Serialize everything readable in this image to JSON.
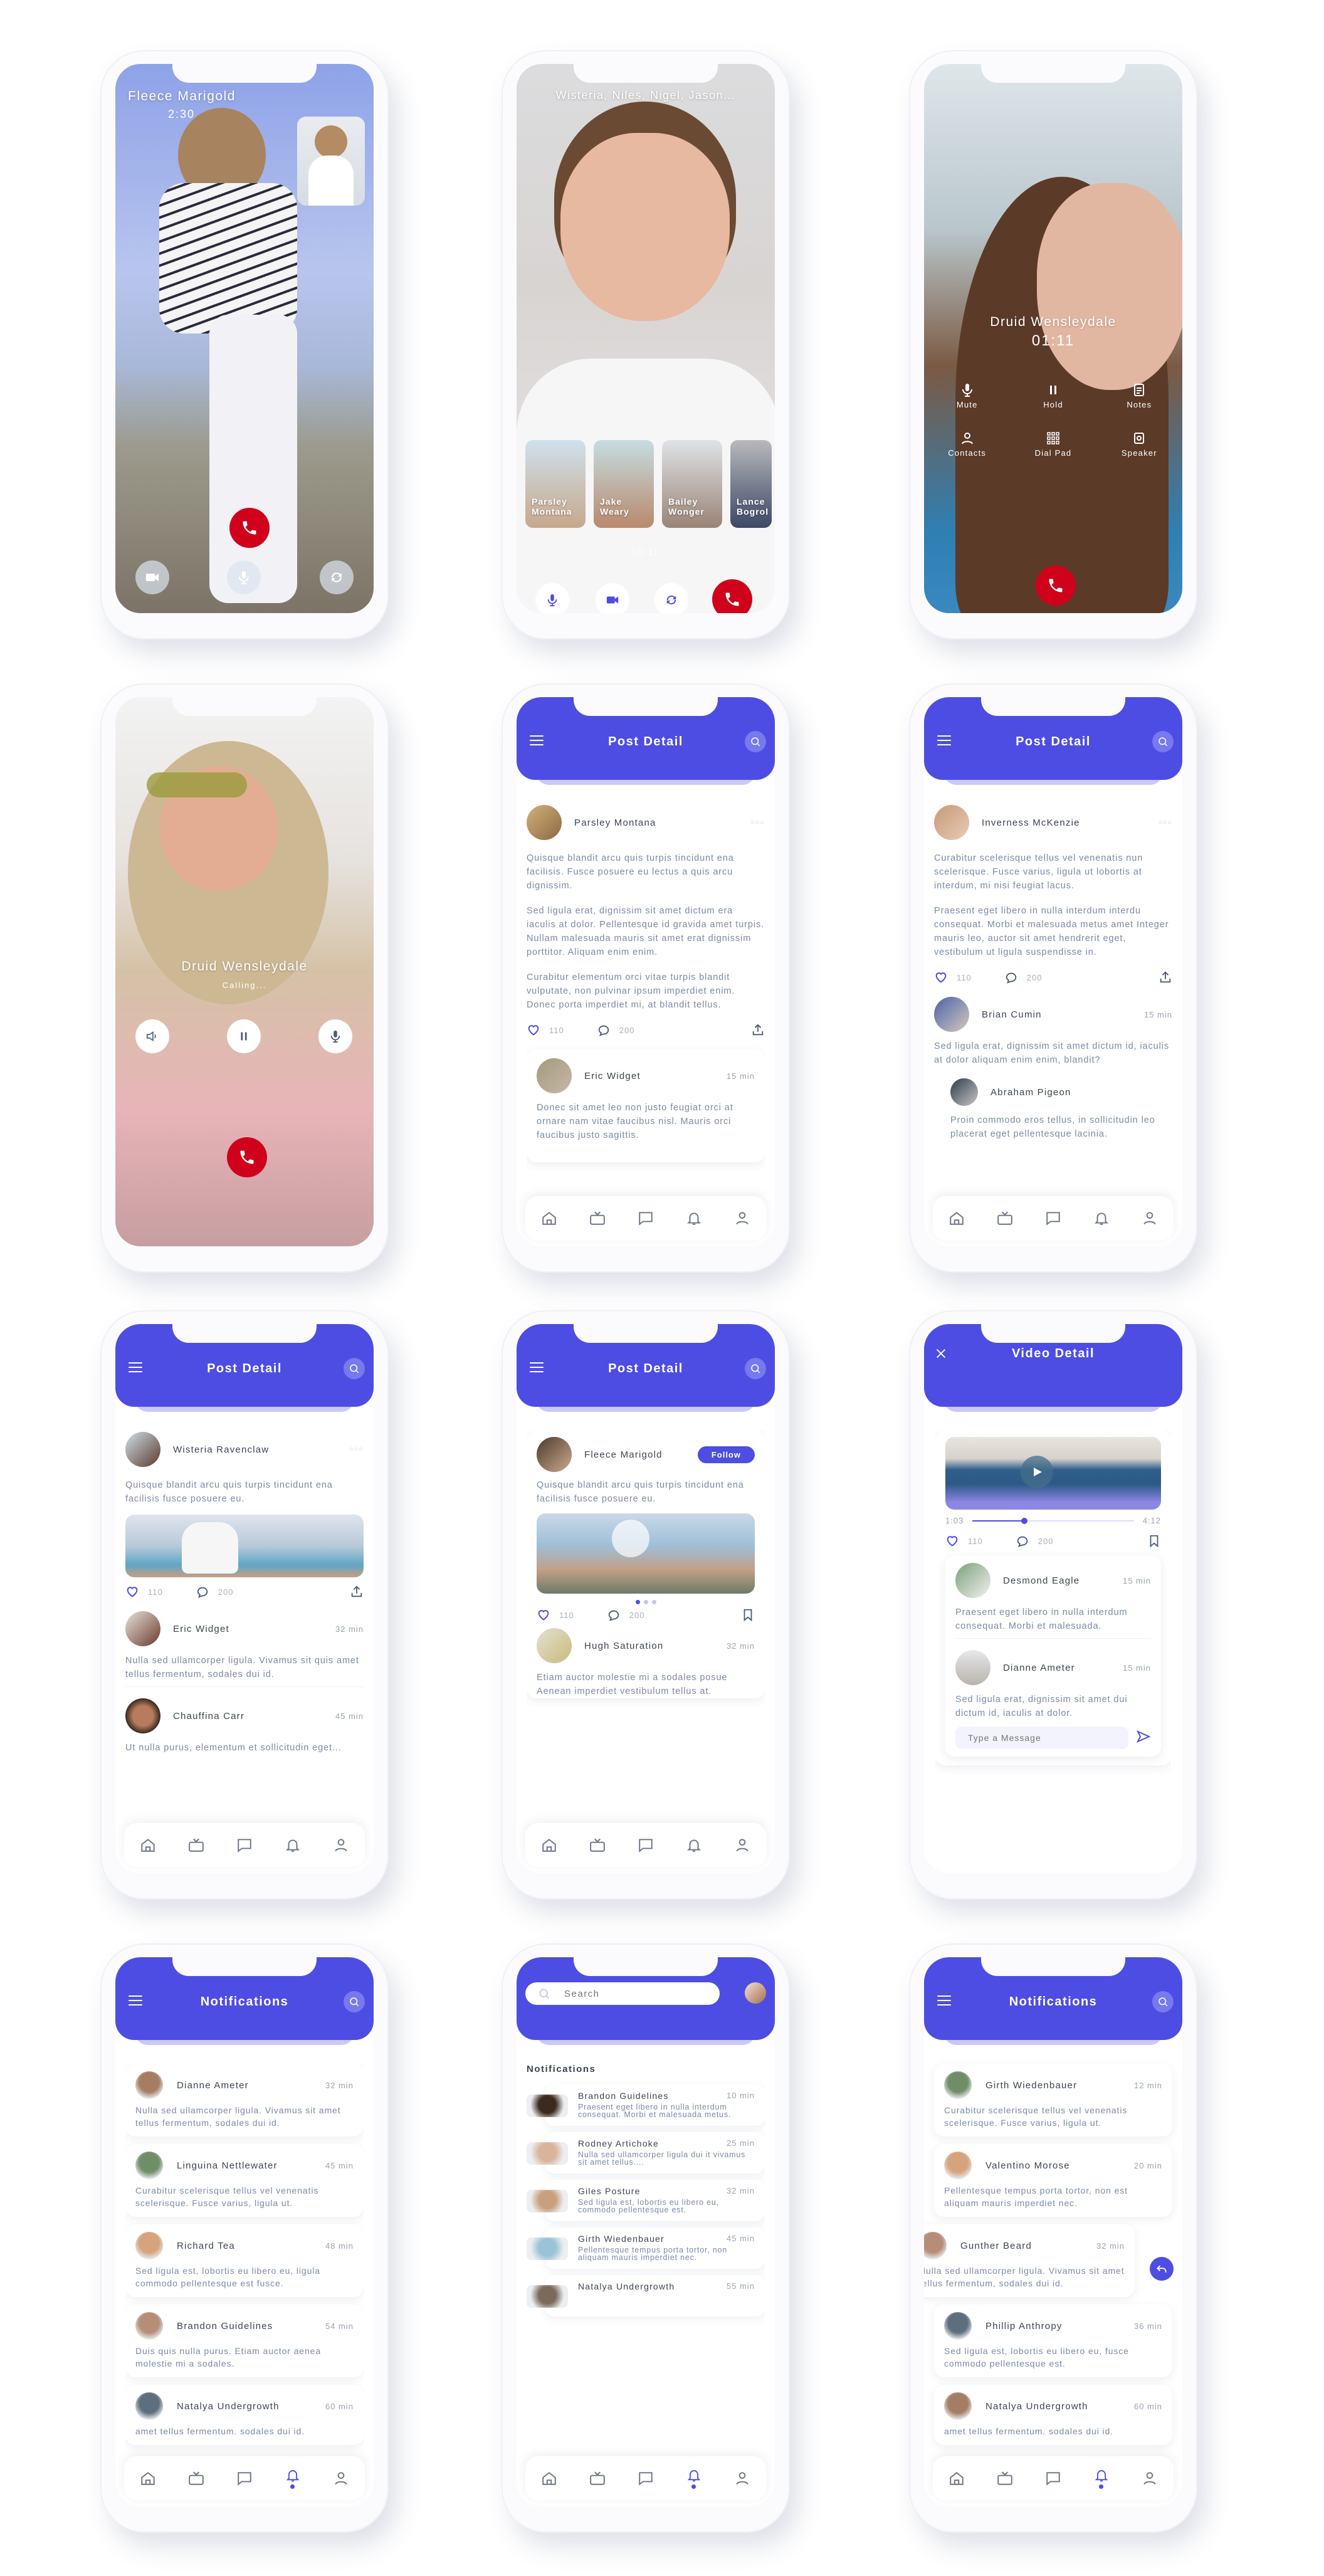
{
  "theme": {
    "accent": "#4d4de4",
    "end_call": "#d0021b",
    "text": "#3c4455",
    "muted": "#7a8aa6"
  },
  "screens": {
    "video_call_1v1": {
      "caller_name": "Fleece Marigold",
      "duration": "2:30",
      "controls": [
        "video-camera-icon",
        "microphone-icon",
        "switch-camera-icon"
      ],
      "end_call_icon": "phone-icon"
    },
    "group_video_call": {
      "participants_title": "Wisteria, Niles, Nigel, Jason...",
      "duration": "05:11",
      "participants": [
        {
          "first": "Parsley",
          "last": "Montana"
        },
        {
          "first": "Jake",
          "last": "Weary"
        },
        {
          "first": "Bailey",
          "last": "Wonger"
        },
        {
          "first": "Lance",
          "last": "Bogrol"
        }
      ],
      "controls": [
        "microphone-icon",
        "video-camera-icon",
        "switch-camera-icon",
        "phone-icon"
      ]
    },
    "audio_call_active": {
      "caller_name": "Druid Wensleydale",
      "duration": "01:11",
      "actions": [
        {
          "label": "Mute",
          "icon": "mute-icon"
        },
        {
          "label": "Hold",
          "icon": "pause-icon"
        },
        {
          "label": "Notes",
          "icon": "notes-icon"
        },
        {
          "label": "Contacts",
          "icon": "contacts-icon"
        },
        {
          "label": "Dial Pad",
          "icon": "dialpad-icon"
        },
        {
          "label": "Speaker",
          "icon": "speaker-icon"
        }
      ]
    },
    "audio_call_calling": {
      "caller_name": "Druid Wensleydale",
      "status": "Calling...",
      "controls": [
        "speaker-icon",
        "pause-icon",
        "microphone-icon"
      ]
    },
    "post_detail_text": {
      "title": "Post Detail",
      "author": "Parsley Montana",
      "paragraphs": [
        "Quisque blandit arcu quis turpis tincidunt ena facilisis. Fusce posuere eu lectus a quis arcu dignissim.",
        "Sed ligula erat, dignissim sit amet dictum era iaculis at dolor. Pellentesque id gravida amet turpis. Nullam malesuada mauris sit amet erat dignissim porttitor. Aliquam enim enim.",
        "Curabitur elementum orci vitae turpis blandit vulputate, non pulvinar ipsum imperdiet enim. Donec porta imperdiet mi, at blandit tellus."
      ],
      "likes": "110",
      "comments": "200",
      "comment": {
        "author": "Eric Widget",
        "time": "15 min",
        "text": "Donec sit amet leo non justo feugiat orci at ornare nam vitae faucibus nisl. Mauris orci faucibus justo sagittis."
      }
    },
    "post_detail_thread": {
      "title": "Post Detail",
      "author": "Inverness McKenzie",
      "paragraphs": [
        "Curabitur scelerisque tellus vel venenatis nun scelerisque. Fusce varius, ligula ut lobortis at interdum, mi nisi feugiat lacus.",
        "Praesent eget libero in nulla interdum interdu consequat. Morbi et malesuada metus amet Integer mauris leo, auctor sit amet hendrerit eget, vestibulum ut ligula suspendisse in."
      ],
      "likes": "110",
      "comments": "200",
      "comment": {
        "author": "Brian Cumin",
        "time": "15 min",
        "text": "Sed ligula erat, dignissim sit amet dictum id, iaculis at dolor aliquam enim enim, blandit?"
      },
      "reply": {
        "author": "Abraham Pigeon",
        "text": "Proin commodo eros tellus, in sollicitudin leo placerat eget pellentesque lacinia."
      }
    },
    "post_detail_image": {
      "title": "Post Detail",
      "author": "Wisteria Ravenclaw",
      "text": "Quisque blandit arcu quis turpis tincidunt ena facilisis fusce posuere eu.",
      "likes": "110",
      "comments": "200",
      "comments_list": [
        {
          "author": "Eric Widget",
          "time": "32 min",
          "text": "Nulla sed ullamcorper ligula. Vivamus sit quis amet tellus fermentum, sodales dui id."
        },
        {
          "author": "Chauffina Carr",
          "time": "45 min",
          "text": "Ut nulla purus, elementum et sollicitudin eget..."
        }
      ]
    },
    "post_detail_follow": {
      "title": "Post Detail",
      "author": "Fleece Marigold",
      "follow_label": "Follow",
      "text": "Quisque blandit arcu quis turpis tincidunt ena facilisis fusce posuere eu.",
      "carousel": {
        "total": 3,
        "active": 1
      },
      "likes": "110",
      "comments": "200",
      "comment": {
        "author": "Hugh Saturation",
        "time": "32 min",
        "text": "Etiam auctor molestie mi a sodales posue Aenean imperdiet vestibulum tellus at."
      }
    },
    "video_detail": {
      "title": "Video Detail",
      "elapsed": "1:03",
      "total": "4:12",
      "progress": 0.32,
      "likes": "110",
      "comments": "200",
      "comments_list": [
        {
          "author": "Desmond Eagle",
          "time": "15 min",
          "text": "Praesent eget libero in nulla interdum consequat. Morbi et malesuada."
        },
        {
          "author": "Dianne Ameter",
          "time": "15 min",
          "text": "Sed ligula erat, dignissim sit amet dui dictum id, iaculis at dolor."
        }
      ],
      "message_placeholder": "Type a Message"
    },
    "notifications_cards": {
      "title": "Notifications",
      "items": [
        {
          "author": "Dianne Ameter",
          "time": "32 min",
          "text": "Nulla sed ullamcorper ligula. Vivamus sit amet tellus fermentum, sodales dui id."
        },
        {
          "author": "Linguina Nettlewater",
          "time": "45 min",
          "text": "Curabitur scelerisque tellus vel venenatis scelerisque. Fusce varius, ligula ut."
        },
        {
          "author": "Richard Tea",
          "time": "48 min",
          "text": "Sed ligula est, lobortis eu libero eu, ligula commodo pellentesque est fusce."
        },
        {
          "author": "Brandon Guidelines",
          "time": "54 min",
          "text": "Duis quis nulla purus. Etiam auctor aenea molestie mi a sodales."
        },
        {
          "author": "Natalya Undergrowth",
          "time": "60 min",
          "text": "amet tellus fermentum. sodales dui id."
        }
      ]
    },
    "notifications_search": {
      "search_placeholder": "Search",
      "section_title": "Notifications",
      "items": [
        {
          "author": "Brandon Guidelines",
          "time": "10 min",
          "text": "Praesent eget libero in nulla interdum consequat. Morbi et malesuada metus."
        },
        {
          "author": "Rodney Artichoke",
          "time": "25 min",
          "text": "Nulla sed ullamcorper ligula dui it vivamus sit amet tellus...."
        },
        {
          "author": "Giles Posture",
          "time": "32 min",
          "text": "Sed ligula est, lobortis eu libero eu, commodo pellentesque est."
        },
        {
          "author": "Girth Wiedenbauer",
          "time": "45 min",
          "text": "Pellentesque tempus porta tortor, non aliquam mauris imperdiet nec."
        },
        {
          "author": "Natalya Undergrowth",
          "time": "55 min",
          "text": ""
        }
      ]
    },
    "notifications_swipe": {
      "title": "Notifications",
      "items": [
        {
          "author": "Girth Wiedenbauer",
          "time": "12 min",
          "text": "Curabitur scelerisque tellus vel venenatis scelerisque. Fusce varius, ligula ut."
        },
        {
          "author": "Valentino Morose",
          "time": "20 min",
          "text": "Pellentesque tempus porta tortor, non est aliquam mauris imperdiet nec."
        },
        {
          "author": "Gunther Beard",
          "time": "32 min",
          "text": "Nulla sed ullamcorper ligula. Vivamus sit amet tellus fermentum, sodales dui id."
        },
        {
          "author": "Phillip Anthropy",
          "time": "36 min",
          "text": "Sed ligula est, lobortis eu libero eu, fusce commodo pellentesque est."
        },
        {
          "author": "Natalya Undergrowth",
          "time": "60 min",
          "text": "amet tellus fermentum. sodales dui id."
        }
      ]
    }
  },
  "tabbar": [
    "home-icon",
    "tv-icon",
    "chat-icon",
    "bell-icon",
    "profile-icon"
  ]
}
